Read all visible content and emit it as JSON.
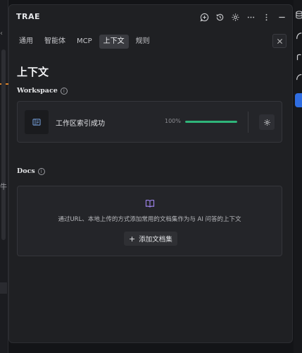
{
  "app": {
    "title": "TRAE"
  },
  "title_actions": [
    {
      "name": "new-chat-icon",
      "label": "new chat"
    },
    {
      "name": "history-icon",
      "label": "history"
    },
    {
      "name": "settings-icon",
      "label": "settings"
    },
    {
      "name": "more-horizontal-icon",
      "label": "more"
    },
    {
      "name": "more-vertical-icon",
      "label": "menu"
    },
    {
      "name": "minimize-icon",
      "label": "minimize"
    }
  ],
  "tabs": [
    {
      "label": "通用",
      "active": false
    },
    {
      "label": "智能体",
      "active": false
    },
    {
      "label": "MCP",
      "active": false
    },
    {
      "label": "上下文",
      "active": true
    },
    {
      "label": "规则",
      "active": false
    }
  ],
  "page_title": "上下文",
  "workspace": {
    "label": "Workspace",
    "status": "工作区索引成功",
    "percent_text": "100%",
    "progress": 1.0
  },
  "docs": {
    "label": "Docs",
    "description": "通过URL、本地上传的方式添加常用的文档集作为与 AI 问答的上下文",
    "add_button": "添加文档集"
  },
  "colors": {
    "progress": "#2fb57a",
    "book_icon": "#a78bfa",
    "active_sidebar": "#2f6de1"
  }
}
